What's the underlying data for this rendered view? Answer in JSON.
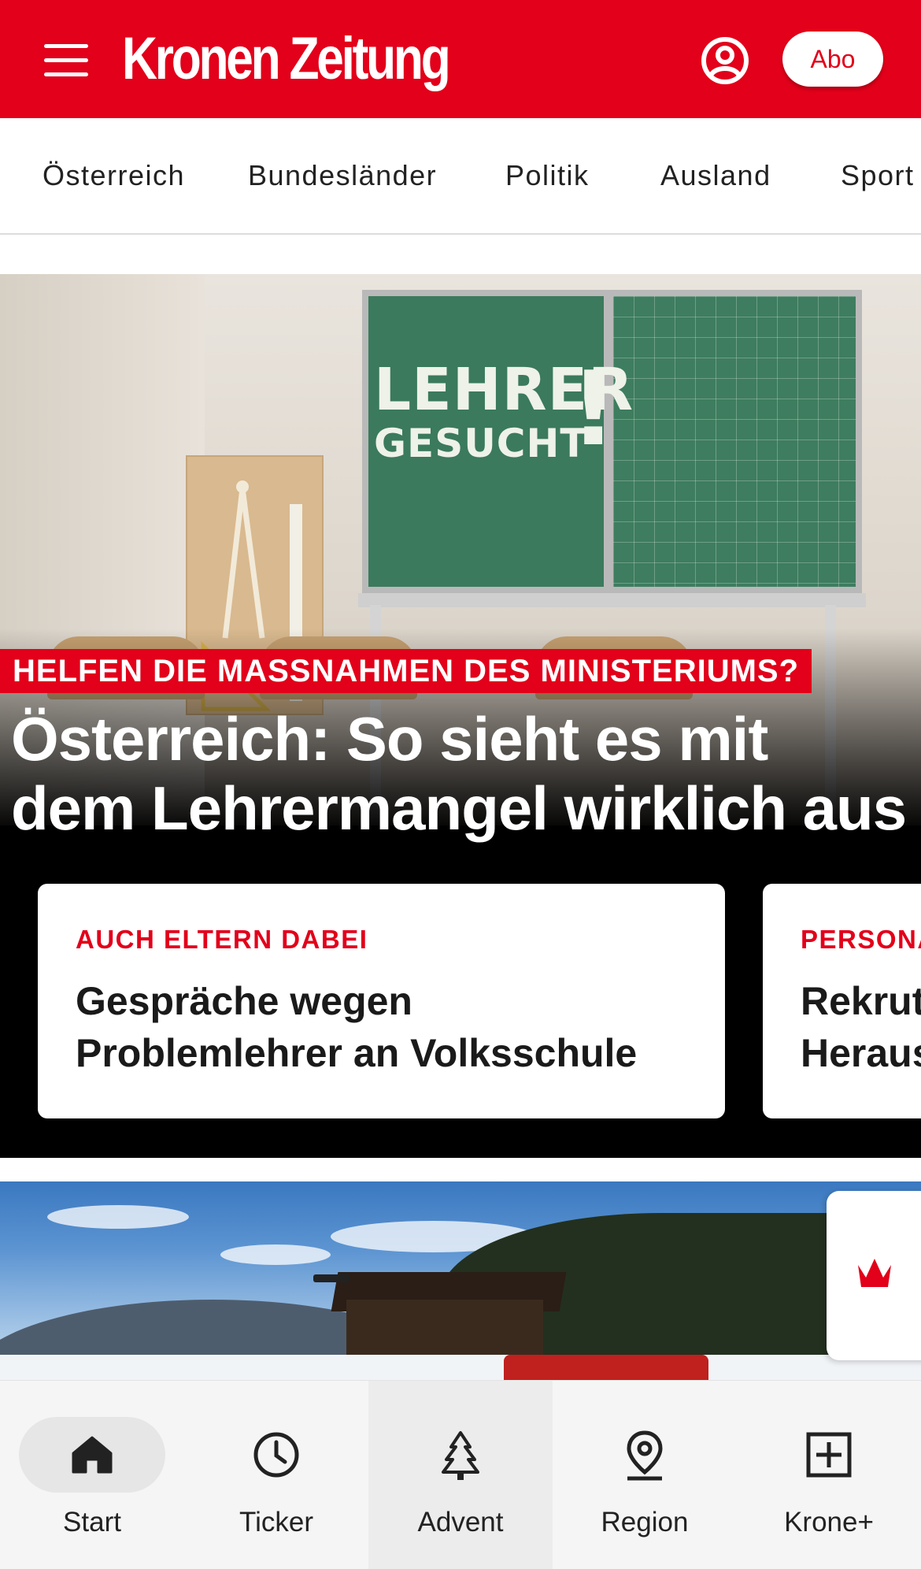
{
  "header": {
    "logo_text": "Kronen Zeitung",
    "menu_icon": "hamburger-menu-icon",
    "user_icon": "user-circle-icon",
    "abo_label": "Abo",
    "brand_color": "#e2001a"
  },
  "nav": {
    "items": [
      {
        "label": "Österreich"
      },
      {
        "label": "Bundesländer"
      },
      {
        "label": "Politik"
      },
      {
        "label": "Ausland"
      },
      {
        "label": "Sport"
      }
    ]
  },
  "hero": {
    "image_chalk_line1": "LEHRER",
    "image_chalk_line2": "GESUCHT",
    "image_chalk_mark": "!",
    "kicker": "HELFEN DIE MASSNAHMEN DES MINISTERIUMS?",
    "headline_line1": "Österreich: So sieht es mit",
    "headline_line2": "dem Lehrermangel wirklich aus",
    "related": [
      {
        "kicker": "AUCH ELTERN DABEI",
        "title_line1": "Gespräche wegen",
        "title_line2": "Problemlehrer an Volksschule"
      },
      {
        "kicker": "PERSONA",
        "title_line1": "Rekrut",
        "title_line2": "Heraus"
      }
    ]
  },
  "floating_tab": {
    "icon": "krone-crown-icon",
    "color": "#e2001a"
  },
  "bottom_nav": {
    "items": [
      {
        "label": "Start",
        "icon": "home-icon",
        "selected": true
      },
      {
        "label": "Ticker",
        "icon": "clock-icon",
        "selected": false
      },
      {
        "label": "Advent",
        "icon": "tree-icon",
        "selected": false
      },
      {
        "label": "Region",
        "icon": "location-pin-icon",
        "selected": false
      },
      {
        "label": "Krone+",
        "icon": "plus-square-icon",
        "selected": false
      }
    ]
  }
}
